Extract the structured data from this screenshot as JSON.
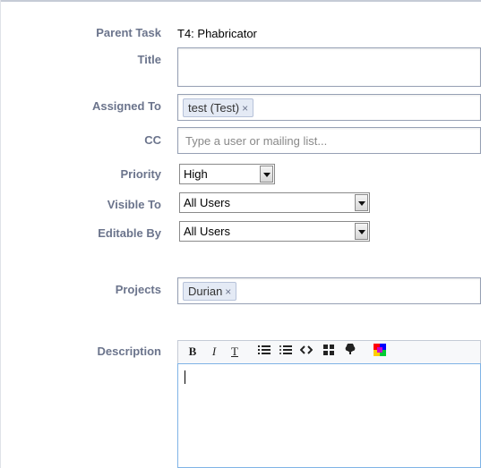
{
  "form": {
    "parent_task": {
      "label": "Parent Task",
      "value": "T4: Phabricator"
    },
    "title": {
      "label": "Title",
      "value": ""
    },
    "assigned_to": {
      "label": "Assigned To",
      "tokens": [
        "test (Test)"
      ]
    },
    "cc": {
      "label": "CC",
      "placeholder": "Type a user or mailing list..."
    },
    "priority": {
      "label": "Priority",
      "selected": "High"
    },
    "visible_to": {
      "label": "Visible To",
      "selected": "All Users"
    },
    "editable_by": {
      "label": "Editable By",
      "selected": "All Users"
    },
    "projects": {
      "label": "Projects",
      "tokens": [
        "Durian"
      ]
    },
    "description": {
      "label": "Description",
      "toolbar": [
        "bold-icon",
        "italic-icon",
        "heading-icon",
        "bullet-list-icon",
        "numbered-list-icon",
        "code-icon",
        "table-icon",
        "upload-icon",
        "color-icon"
      ],
      "value": ""
    }
  },
  "token_remove_glyph": "×"
}
